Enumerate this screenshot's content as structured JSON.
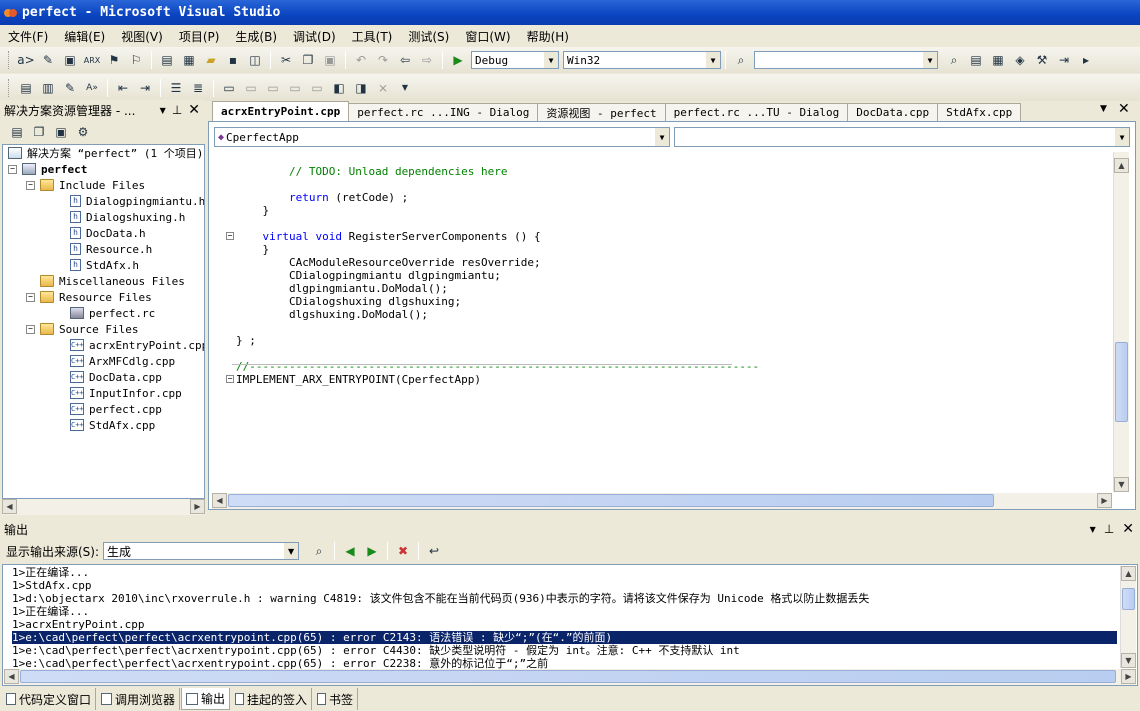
{
  "window": {
    "title": "perfect - Microsoft Visual Studio"
  },
  "menu": [
    "文件(F)",
    "编辑(E)",
    "视图(V)",
    "项目(P)",
    "生成(B)",
    "调试(D)",
    "工具(T)",
    "测试(S)",
    "窗口(W)",
    "帮助(H)"
  ],
  "toolbar": {
    "config": "Debug",
    "platform": "Win32",
    "find": ""
  },
  "solution_explorer": {
    "title": "解决方案资源管理器 - ...",
    "solution": "解决方案 “perfect” (1 个项目)",
    "project": "perfect",
    "nodes": [
      {
        "label": "Include Files",
        "type": "folder",
        "level": 1
      },
      {
        "label": "Dialogpingmiantu.h",
        "type": "h",
        "level": 2
      },
      {
        "label": "Dialogshuxing.h",
        "type": "h",
        "level": 2
      },
      {
        "label": "DocData.h",
        "type": "h",
        "level": 2
      },
      {
        "label": "Resource.h",
        "type": "h",
        "level": 2
      },
      {
        "label": "StdAfx.h",
        "type": "h",
        "level": 2
      },
      {
        "label": "Miscellaneous Files",
        "type": "folder",
        "level": 1
      },
      {
        "label": "Resource Files",
        "type": "folder",
        "level": 1
      },
      {
        "label": "perfect.rc",
        "type": "rc",
        "level": 2
      },
      {
        "label": "Source Files",
        "type": "folder",
        "level": 1
      },
      {
        "label": "acrxEntryPoint.cpp",
        "type": "cpp",
        "level": 2
      },
      {
        "label": "ArxMFCdlg.cpp",
        "type": "cpp",
        "level": 2
      },
      {
        "label": "DocData.cpp",
        "type": "cpp",
        "level": 2
      },
      {
        "label": "InputInfor.cpp",
        "type": "cpp",
        "level": 2
      },
      {
        "label": "perfect.cpp",
        "type": "cpp",
        "level": 2
      },
      {
        "label": "StdAfx.cpp",
        "type": "cpp",
        "level": 2
      }
    ]
  },
  "editor_tabs": [
    "acrxEntryPoint.cpp",
    "perfect.rc ...ING - Dialog",
    "资源视图 - perfect",
    "perfect.rc ...TU - Dialog",
    "DocData.cpp",
    "StdAfx.cpp"
  ],
  "editor": {
    "class_combo": "CperfectApp",
    "member_combo": "",
    "lines": [
      {
        "text": "        // TODO: Unload dependencies here",
        "cls": "cm"
      },
      {
        "text": "",
        "cls": ""
      },
      {
        "text": "        return (retCode) ;",
        "cls": "ret"
      },
      {
        "text": "    }",
        "cls": ""
      },
      {
        "text": "",
        "cls": ""
      },
      {
        "text": "    virtual void RegisterServerComponents () {",
        "cls": "virt"
      },
      {
        "text": "    }",
        "cls": ""
      },
      {
        "text": "        CAcModuleResourceOverride resOverride;",
        "cls": ""
      },
      {
        "text": "        CDialogpingmiantu dlgpingmiantu;",
        "cls": ""
      },
      {
        "text": "        dlgpingmiantu.DoModal();",
        "cls": ""
      },
      {
        "text": "        CDialogshuxing dlgshuxing;",
        "cls": ""
      },
      {
        "text": "        dlgshuxing.DoModal();",
        "cls": ""
      },
      {
        "text": "",
        "cls": ""
      },
      {
        "text": "} ;",
        "cls": ""
      },
      {
        "text": "",
        "cls": ""
      },
      {
        "text": "//-----------------------------------------------------------------------------",
        "cls": "cm"
      },
      {
        "text": "IMPLEMENT_ARX_ENTRYPOINT(CperfectApp)",
        "cls": ""
      }
    ]
  },
  "output": {
    "title": "输出",
    "source_label": "显示输出来源(S):",
    "source_value": "生成",
    "lines": [
      "1>正在编译...",
      "1>StdAfx.cpp",
      "1>d:\\objectarx 2010\\inc\\rxoverrule.h : warning C4819: 该文件包含不能在当前代码页(936)中表示的字符。请将该文件保存为 Unicode 格式以防止数据丢失",
      "1>正在编译...",
      "1>acrxEntryPoint.cpp",
      "1>e:\\cad\\perfect\\perfect\\acrxentrypoint.cpp(65) : error C2143: 语法错误 : 缺少“;”(在“.”的前面)",
      "1>e:\\cad\\perfect\\perfect\\acrxentrypoint.cpp(65) : error C4430: 缺少类型说明符 - 假定为 int。注意: C++ 不支持默认 int",
      "1>e:\\cad\\perfect\\perfect\\acrxentrypoint.cpp(65) : error C2238: 意外的标记位于“;”之前"
    ],
    "selected_line": 5
  },
  "bottom_tabs": [
    "代码定义窗口",
    "调用浏览器",
    "输出",
    "挂起的签入",
    "书签"
  ],
  "colors": {
    "title_bar": "#0a44c0",
    "selection": "#0a246a",
    "keyword": "#0000ff",
    "comment": "#008000"
  }
}
